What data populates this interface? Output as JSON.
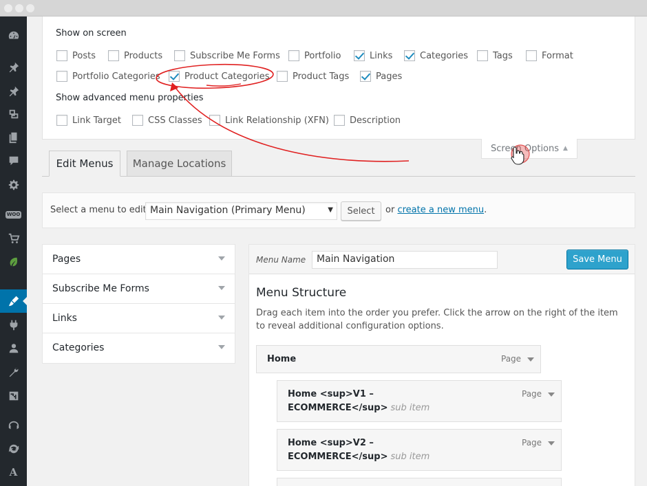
{
  "colors": {
    "admin_sidebar": "#23282d",
    "accent_blue": "#0073aa",
    "annotation_red": "#e02020",
    "save_button": "#2ea2cc"
  },
  "sidebar": {
    "icons": [
      "dashboard-icon",
      "pin-icon",
      "pin-icon",
      "media-icon",
      "pages-icon",
      "comments-icon",
      "gear-icon",
      "woocommerce-icon",
      "cart-icon",
      "leaf-icon",
      "appearance-brush-icon",
      "plugins-icon",
      "users-icon",
      "tools-wrench-icon",
      "settings-sliders-icon",
      "support-icon",
      "refresh-icon",
      "font-a-icon",
      "wrench-cross-icon"
    ],
    "woo_label": "WOO",
    "letter": "A"
  },
  "screen_options": {
    "show_on_screen_title": "Show on screen",
    "items": [
      {
        "label": "Posts",
        "checked": false
      },
      {
        "label": "Products",
        "checked": false
      },
      {
        "label": "Subscribe Me Forms",
        "checked": false
      },
      {
        "label": "Portfolio",
        "checked": false
      },
      {
        "label": "Links",
        "checked": true
      },
      {
        "label": "Categories",
        "checked": true
      },
      {
        "label": "Tags",
        "checked": false
      },
      {
        "label": "Format",
        "checked": false
      },
      {
        "label": "Portfolio Categories",
        "checked": false
      },
      {
        "label": "Product Categories",
        "checked": true
      },
      {
        "label": "Product Tags",
        "checked": false
      },
      {
        "label": "Pages",
        "checked": true
      }
    ],
    "advanced_title": "Show advanced menu properties",
    "advanced_items": [
      {
        "label": "Link Target",
        "checked": false
      },
      {
        "label": "CSS Classes",
        "checked": false
      },
      {
        "label": "Link Relationship (XFN)",
        "checked": false
      },
      {
        "label": "Description",
        "checked": false
      }
    ],
    "toggle_label": "Screen Options",
    "toggle_arrow": "▲"
  },
  "tabs": [
    {
      "label": "Edit Menus",
      "active": true
    },
    {
      "label": "Manage Locations",
      "active": false
    }
  ],
  "select_menu": {
    "label": "Select a menu to edit:",
    "selected": "Main Navigation (Primary Menu)",
    "button": "Select",
    "or_text": "or",
    "create_link": "create a new menu",
    "period": "."
  },
  "accordion": [
    "Pages",
    "Subscribe Me Forms",
    "Links",
    "Categories"
  ],
  "menu_editor": {
    "name_label": "Menu Name",
    "name_value": "Main Navigation",
    "save_button": "Save Menu",
    "structure_title": "Menu Structure",
    "structure_desc": "Drag each item into the order you prefer. Click the arrow on the right of the item to reveal additional configuration options.",
    "items": [
      {
        "line1": "Home",
        "line2": "",
        "sub": "",
        "type": "Page"
      },
      {
        "line1": "Home <sup>V1 –",
        "line2": "ECOMMERCE</sup>",
        "sub": "sub item",
        "type": "Page"
      },
      {
        "line1": "Home <sup>V2 –",
        "line2": "ECOMMERCE</sup>",
        "sub": "sub item",
        "type": "Page"
      }
    ]
  }
}
